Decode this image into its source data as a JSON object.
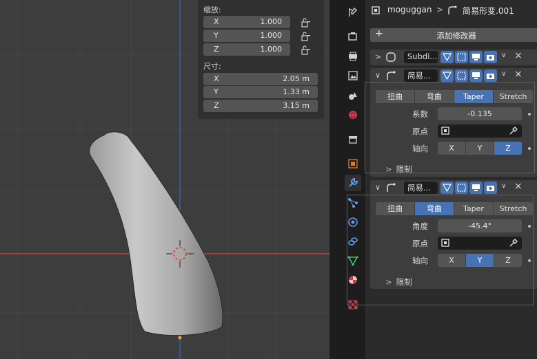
{
  "viewport": {
    "scale": {
      "title": "缩放:",
      "rows": [
        {
          "axis": "X",
          "value": "1.000"
        },
        {
          "axis": "Y",
          "value": "1.000"
        },
        {
          "axis": "Z",
          "value": "1.000"
        }
      ]
    },
    "dimensions": {
      "title": "尺寸:",
      "rows": [
        {
          "axis": "X",
          "value": "2.05 m"
        },
        {
          "axis": "Y",
          "value": "1.33 m"
        },
        {
          "axis": "Z",
          "value": "3.15 m"
        }
      ]
    }
  },
  "properties": {
    "breadcrumb": {
      "object": "moguggan",
      "separator": ">",
      "modifier": "简易形变.001"
    },
    "add_modifier_label": "添加修改器",
    "modifiers": [
      {
        "name": "Subdi...",
        "expanded": false
      },
      {
        "name": "简易...",
        "expanded": true,
        "modes": [
          "扭曲",
          "弯曲",
          "Taper",
          "Stretch"
        ],
        "active_mode": "Taper",
        "param_label": "系数",
        "param_value": "-0.135",
        "origin_label": "原点",
        "axis_label": "轴向",
        "axes": [
          "X",
          "Y",
          "Z"
        ],
        "active_axis": "Z",
        "restrict_label": "限制"
      },
      {
        "name": "简易...",
        "expanded": true,
        "modes": [
          "扭曲",
          "弯曲",
          "Taper",
          "Stretch"
        ],
        "active_mode": "弯曲",
        "param_label": "角度",
        "param_value": "-45.4°",
        "origin_label": "原点",
        "axis_label": "轴向",
        "axes": [
          "X",
          "Y",
          "Z"
        ],
        "active_axis": "Y",
        "restrict_label": "限制"
      }
    ]
  },
  "colors": {
    "accent": "#4772b3",
    "highlight_box": "#e0262e",
    "x_axis": "#c2404a",
    "y_axis": "#3a5fae",
    "origin": "#f39a2a"
  },
  "tabs": [
    "tool-icon",
    "render-icon",
    "output-icon",
    "view-layer-icon",
    "scene-icon",
    "world-icon",
    "collection-icon",
    "object-icon",
    "modifier-icon",
    "particles-icon",
    "physics-icon",
    "constraints-icon",
    "data-icon",
    "material-icon",
    "texture-icon"
  ]
}
